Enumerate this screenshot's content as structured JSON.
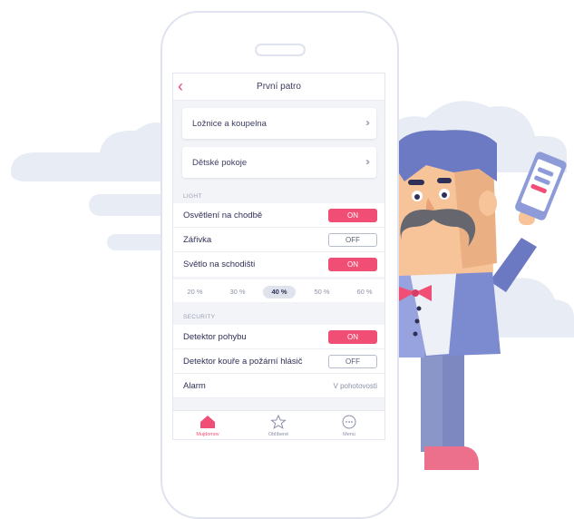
{
  "header": {
    "back_icon": "chevron-left-icon",
    "title": "První patro"
  },
  "rooms": [
    {
      "label": "Ložnice a koupelna",
      "icon": "double-chevron-right-icon"
    },
    {
      "label": "Dětské pokoje",
      "icon": "double-chevron-right-icon"
    }
  ],
  "light": {
    "section_label": "LIGHT",
    "rows": [
      {
        "label": "Osvětlení na chodbě",
        "toggle": "ON"
      },
      {
        "label": "Zářivka",
        "toggle": "OFF"
      },
      {
        "label": "Světlo na schodišti",
        "toggle": "ON"
      }
    ],
    "levels": [
      "20 %",
      "30 %",
      "40 %",
      "50 %",
      "60 %"
    ],
    "selected_level": "40 %"
  },
  "security": {
    "section_label": "SECURITY",
    "rows": [
      {
        "label": "Detektor pohybu",
        "toggle": "ON"
      },
      {
        "label": "Detektor kouře a požární hlásič",
        "toggle": "OFF"
      },
      {
        "label": "Alarm",
        "value": "V pohotovosti"
      }
    ]
  },
  "tabbar": {
    "tabs": [
      {
        "label": "Mujdomov",
        "icon": "home-icon",
        "active": true
      },
      {
        "label": "Oblíbené",
        "icon": "star-icon",
        "active": false
      },
      {
        "label": "Menu",
        "icon": "more-icon",
        "active": false
      }
    ]
  },
  "colors": {
    "accent": "#f04e75",
    "text": "#2f3058",
    "background": "#f3f4f8",
    "cloud": "#e6ebf5",
    "character_suit": "#7c8ad0"
  }
}
